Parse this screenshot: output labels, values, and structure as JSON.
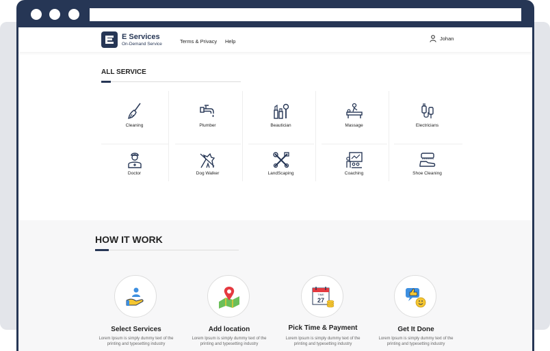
{
  "nav": {
    "brand_name": "E Services",
    "brand_tagline": "On-Demand Service",
    "links": [
      "Terms & Privacy",
      "Help"
    ],
    "user_name": "Johan"
  },
  "services": {
    "title": "ALL SERVICE",
    "items": [
      {
        "label": "Cleaning",
        "icon": "broom-icon"
      },
      {
        "label": "Plumber",
        "icon": "faucet-icon"
      },
      {
        "label": "Beautician",
        "icon": "cosmetics-icon"
      },
      {
        "label": "Massage",
        "icon": "massage-icon"
      },
      {
        "label": "Electricians",
        "icon": "plug-icon"
      },
      {
        "label": "Doctor",
        "icon": "doctor-icon"
      },
      {
        "label": "Dog Walker",
        "icon": "dog-icon"
      },
      {
        "label": "LandScaping",
        "icon": "tools-icon"
      },
      {
        "label": "Coaching",
        "icon": "coaching-icon"
      },
      {
        "label": "Shoe Cleaning",
        "icon": "shoe-icon"
      }
    ]
  },
  "how_it_works": {
    "title": "HOW IT WORK",
    "steps": [
      {
        "title": "Select Services",
        "desc": "Lorem Ipsum is simply dummy text of the printing and typesetting industry",
        "icon": "hand-user-icon"
      },
      {
        "title": "Add  location",
        "desc": "Lorem Ipsum is simply dummy text of the printing and typesetting industry",
        "icon": "map-pin-icon"
      },
      {
        "title": "Pick Time & Payment",
        "desc": "Lorem Ipsum is simply dummy text of the printing and typesetting industry",
        "icon": "calendar-coins-icon"
      },
      {
        "title": "Get It Done",
        "desc": "Lorem Ipsum is simply dummy text of the printing and typesetting industry",
        "icon": "thumbs-up-icon"
      }
    ],
    "calendar_label": "TIME",
    "calendar_day": "27"
  },
  "colors": {
    "brand": "#263655",
    "accent_red": "#e53a40",
    "accent_blue": "#3d8fe0",
    "accent_yellow": "#f5c631"
  }
}
